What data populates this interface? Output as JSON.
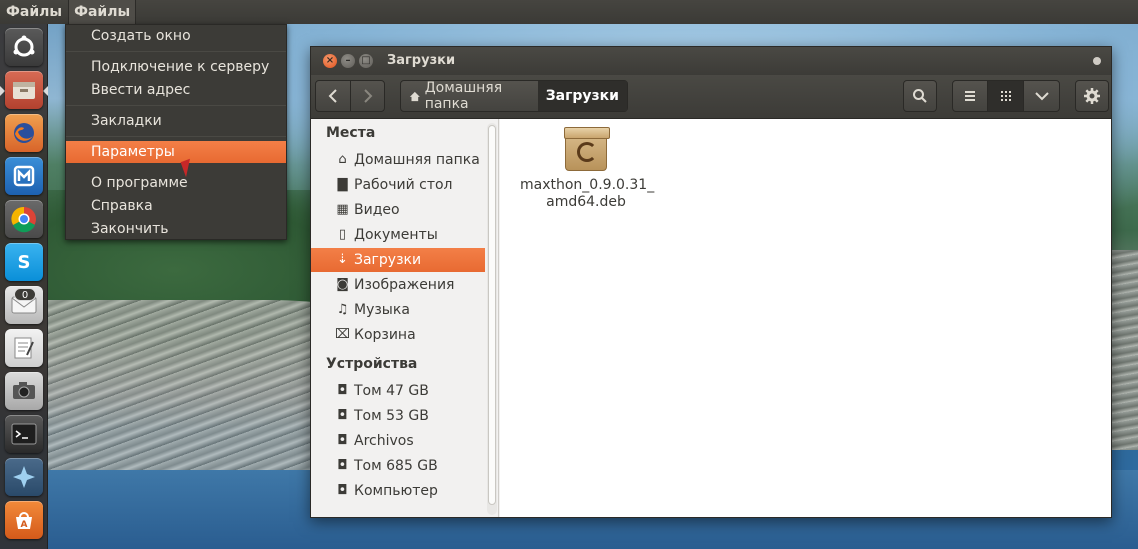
{
  "top_panel": {
    "app_title": "Файлы",
    "menu_label": "Файлы"
  },
  "menu": {
    "items": [
      {
        "label": "Создать окно"
      },
      {
        "label": "Подключение к серверу"
      },
      {
        "label": "Ввести адрес"
      },
      {
        "label": "Закладки"
      },
      {
        "label": "Параметры",
        "selected": true
      },
      {
        "label": "О программе"
      },
      {
        "label": "Справка"
      },
      {
        "label": "Закончить"
      }
    ]
  },
  "launcher": {
    "items": [
      {
        "icon": "ubuntu-dash-icon"
      },
      {
        "icon": "files-icon"
      },
      {
        "icon": "firefox-icon"
      },
      {
        "icon": "maxthon-icon"
      },
      {
        "icon": "chrome-icon"
      },
      {
        "icon": "skype-icon"
      },
      {
        "icon": "mail-icon",
        "badge": "0"
      },
      {
        "icon": "text-editor-icon"
      },
      {
        "icon": "camera-icon"
      },
      {
        "icon": "terminal-icon"
      },
      {
        "icon": "app-icon"
      },
      {
        "icon": "software-center-icon"
      }
    ]
  },
  "window": {
    "title": "Загрузки",
    "breadcrumb": {
      "home": "Домашняя папка",
      "current": "Загрузки"
    },
    "sidebar": {
      "places_header": "Места",
      "places": [
        {
          "label": "Домашняя папка",
          "icon": "home-icon"
        },
        {
          "label": "Рабочий стол",
          "icon": "folder-icon"
        },
        {
          "label": "Видео",
          "icon": "video-icon"
        },
        {
          "label": "Документы",
          "icon": "document-icon"
        },
        {
          "label": "Загрузки",
          "icon": "download-icon",
          "selected": true
        },
        {
          "label": "Изображения",
          "icon": "camera-icon"
        },
        {
          "label": "Музыка",
          "icon": "music-icon"
        },
        {
          "label": "Корзина",
          "icon": "trash-icon"
        }
      ],
      "devices_header": "Устройства",
      "devices": [
        {
          "label": "Том 47 GB",
          "icon": "drive-icon"
        },
        {
          "label": "Том 53 GB",
          "icon": "drive-icon"
        },
        {
          "label": "Archivos",
          "icon": "drive-icon"
        },
        {
          "label": "Том 685 GB",
          "icon": "drive-icon"
        },
        {
          "label": "Компьютер",
          "icon": "drive-icon"
        }
      ]
    },
    "files": [
      {
        "name": "maxthon_0.9.0.31_amd64.deb",
        "line1": "maxthon_0.9.0.31_",
        "line2": "amd64.deb",
        "icon": "debian-package-icon"
      }
    ],
    "colors": {
      "accent": "#e8693a",
      "panel": "#3c3b37"
    }
  }
}
